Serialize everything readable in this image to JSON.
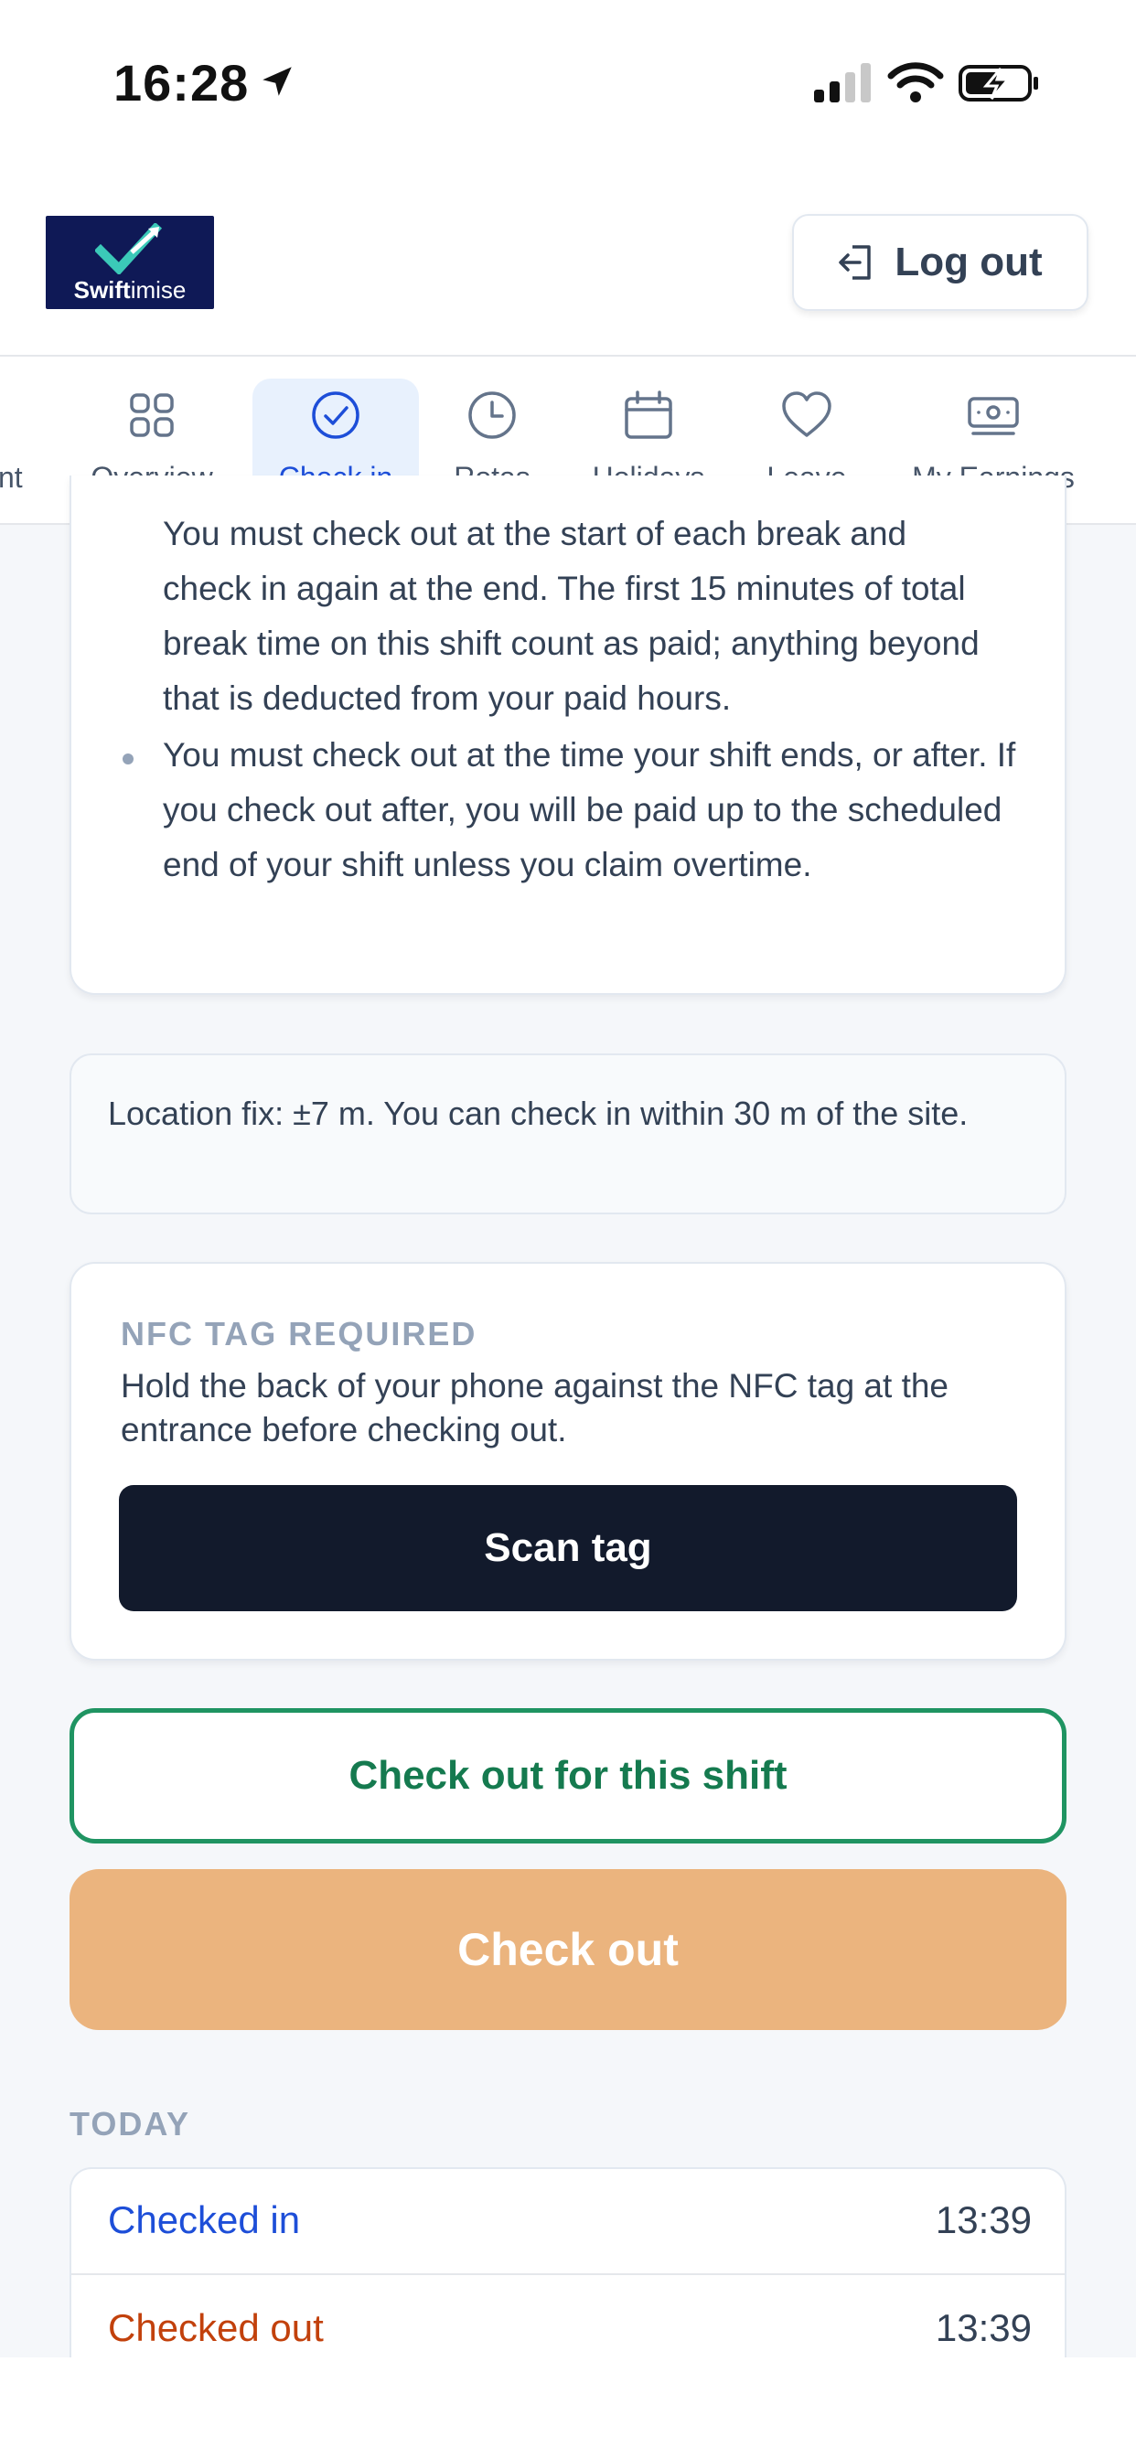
{
  "status_bar": {
    "time": "16:28"
  },
  "header": {
    "logo": {
      "brand_bold": "Swift",
      "brand_regular": "imise"
    },
    "logout_label": "Log out"
  },
  "nav": {
    "partial_label": "nt",
    "items": [
      {
        "label": "Overview",
        "icon": "grid-icon"
      },
      {
        "label": "Check in",
        "icon": "check-circle-icon",
        "active": true
      },
      {
        "label": "Rotas",
        "icon": "clock-icon"
      },
      {
        "label": "Holidays",
        "icon": "calendar-icon"
      },
      {
        "label": "Leave",
        "icon": "heart-icon"
      },
      {
        "label": "My Earnings",
        "icon": "money-icon"
      }
    ]
  },
  "rules": {
    "partial_line": "You must check out at the start of each break and",
    "bullet1_rest": "check in again at the end. The first 15 minutes of total break time on this shift count as paid; anything beyond that is deducted from your paid hours.",
    "bullet2": "You must check out at the time your shift ends, or after. If you check out after, you will be paid up to the scheduled end of your shift unless you claim overtime."
  },
  "location_fix": "Location fix: ±7 m. You can check in within 30 m of the site.",
  "nfc": {
    "title": "NFC TAG REQUIRED",
    "description": "Hold the back of your phone against the NFC tag at the entrance before checking out.",
    "scan_label": "Scan tag"
  },
  "actions": {
    "checkout_shift_label": "Check out for this shift",
    "checkout_label": "Check out"
  },
  "today": {
    "label": "TODAY",
    "entries": [
      {
        "label": "Checked in",
        "time": "13:39"
      },
      {
        "label": "Checked out",
        "time": "13:39"
      }
    ]
  },
  "colors": {
    "accent_blue": "#1d4ed8",
    "success_green": "#1f9462",
    "checkout_orange": "#ebb47e",
    "checked_out_orange": "#c2410c",
    "dark_button": "#121a2c",
    "logo_navy": "#0f1956"
  }
}
